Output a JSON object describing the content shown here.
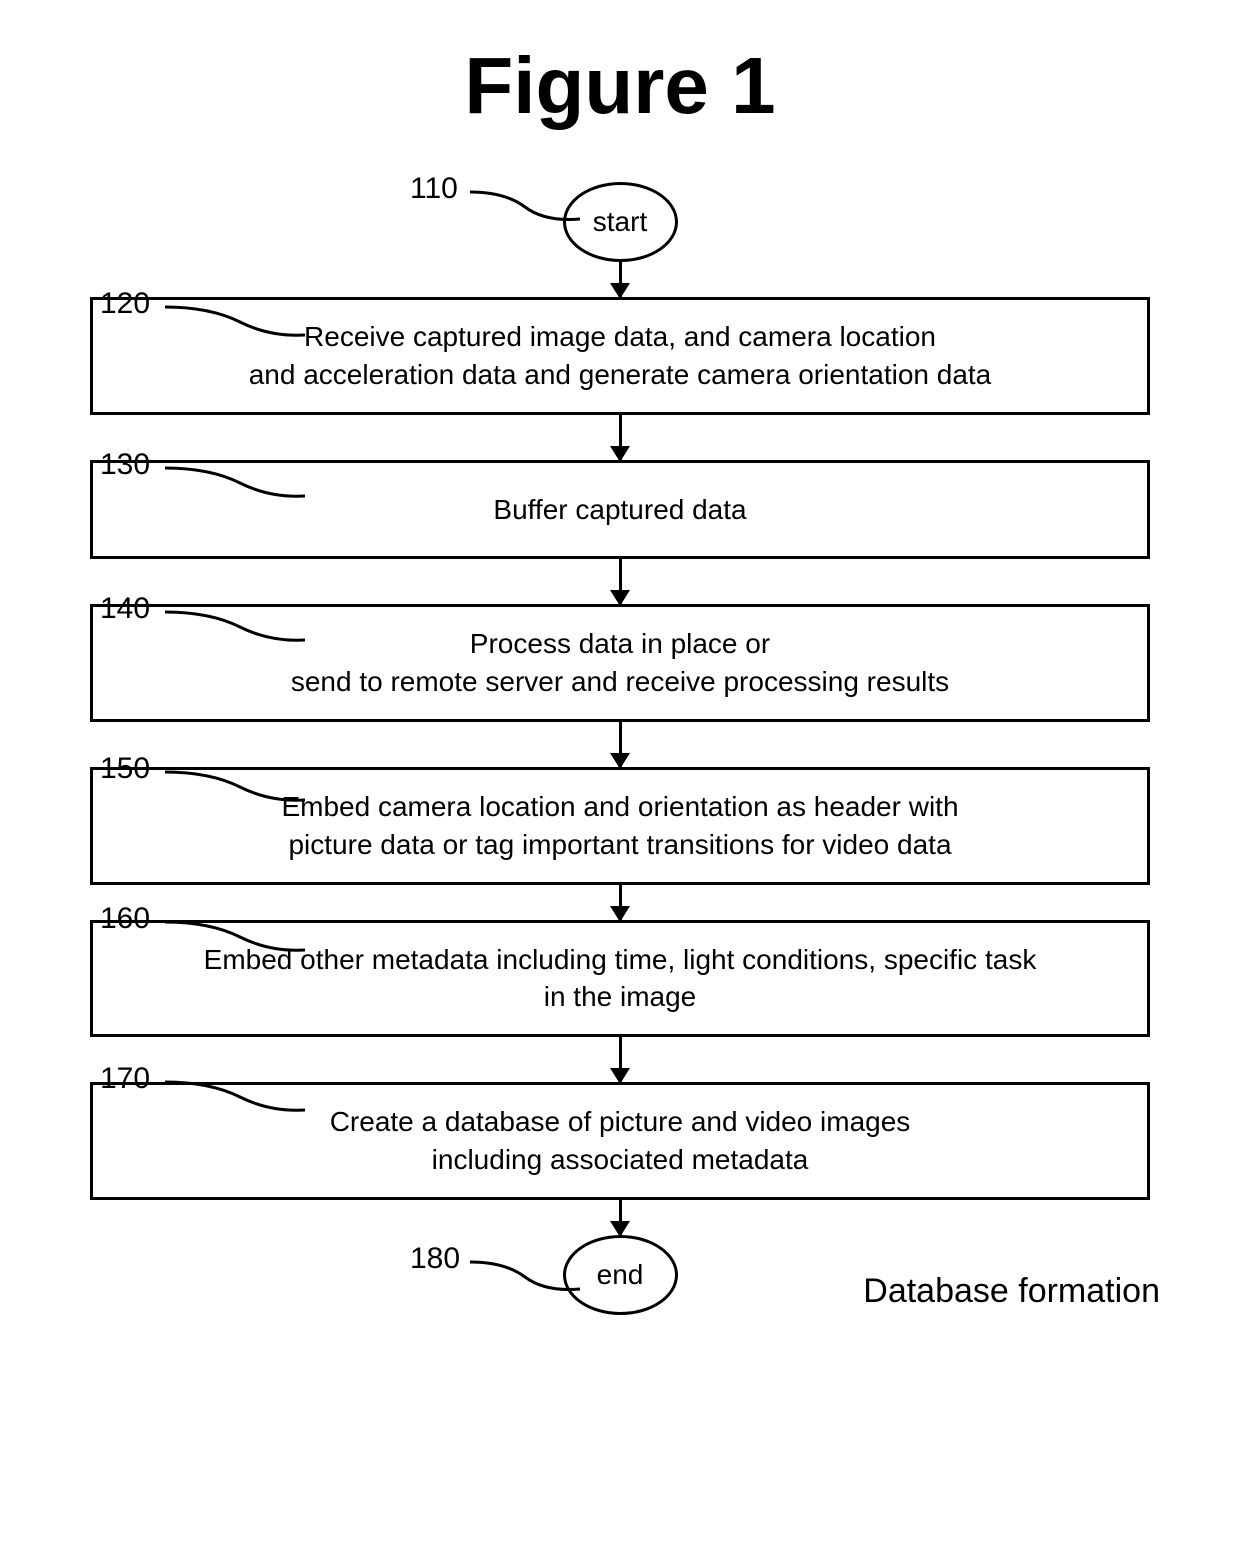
{
  "title": "Figure 1",
  "terminals": {
    "start": "start",
    "end": "end"
  },
  "labels": {
    "n110": "110",
    "n120": "120",
    "n130": "130",
    "n140": "140",
    "n150": "150",
    "n160": "160",
    "n170": "170",
    "n180": "180"
  },
  "steps": {
    "s120": "Receive captured image data, and camera location\nand acceleration data and generate camera orientation data",
    "s130": "Buffer captured data",
    "s140": "Process data in place or\nsend to remote server and receive processing results",
    "s150": "Embed camera location and orientation as header with\npicture data or tag important transitions for video data",
    "s160": "Embed other metadata including time, light conditions, specific task\nin the image",
    "s170": "Create a database of picture and video images\nincluding associated metadata"
  },
  "caption": "Database formation"
}
